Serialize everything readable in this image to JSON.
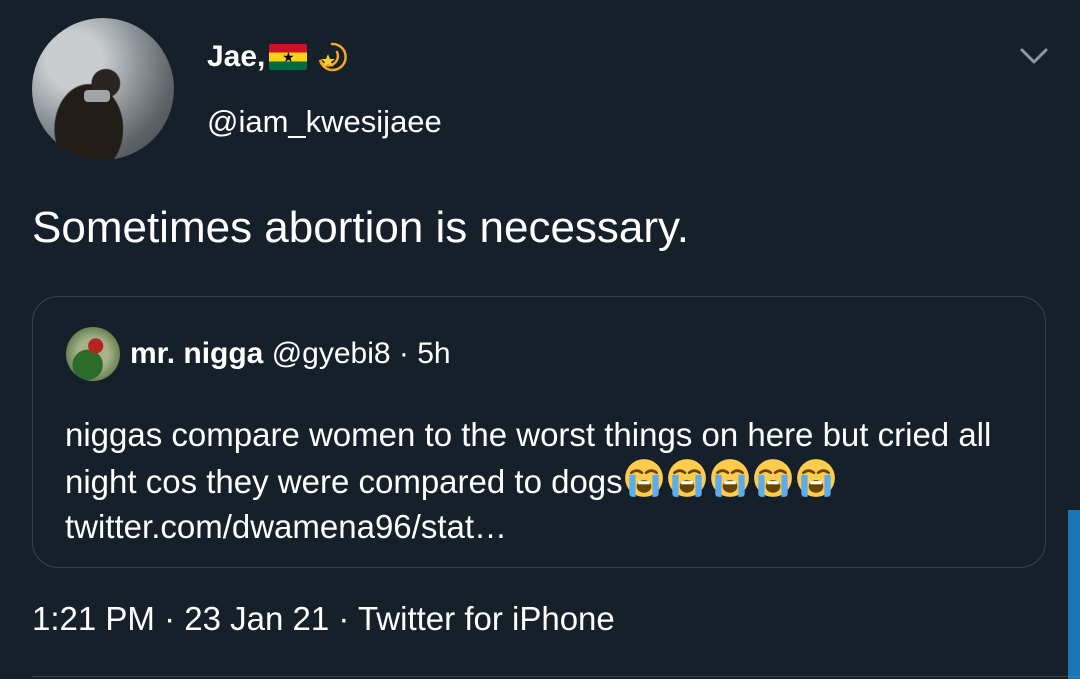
{
  "tweet": {
    "display_name": "Jae,",
    "handle": "@iam_kwesijaee",
    "text": "Sometimes abortion is necessary.",
    "meta": {
      "time": "1:21 PM",
      "date": "23 Jan 21",
      "source": "Twitter for iPhone"
    }
  },
  "quoted": {
    "name": "mr. nigga",
    "handle": "@gyebi8",
    "time": "5h",
    "text": "niggas compare women to the worst things on here but cried all night cos they were compared to dogs",
    "emoji_count": 5,
    "emoji_name": "loudly-crying-face-icon",
    "link": "twitter.com/dwamena96/stat…"
  },
  "separator": "·",
  "colors": {
    "background": "#15202b",
    "text": "#ffffff",
    "border": "#38444d"
  }
}
